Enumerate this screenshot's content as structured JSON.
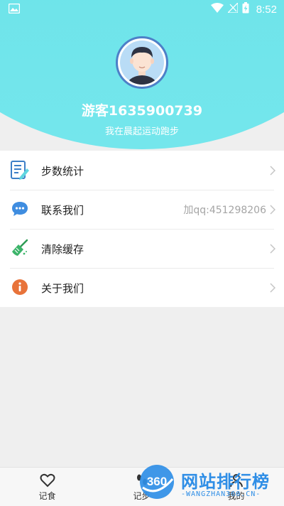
{
  "status_bar": {
    "time": "8:52"
  },
  "profile": {
    "username": "游客1635900739",
    "motto": "我在晨起运动跑步"
  },
  "menu": [
    {
      "label": "步数统计",
      "value": "",
      "icon": "document-edit-icon"
    },
    {
      "label": "联系我们",
      "value": "加qq:451298206",
      "icon": "chat-bubble-icon"
    },
    {
      "label": "清除缓存",
      "value": "",
      "icon": "broom-icon"
    },
    {
      "label": "关于我们",
      "value": "",
      "icon": "info-icon"
    }
  ],
  "tabs": [
    {
      "label": "记食",
      "icon": "heart-icon"
    },
    {
      "label": "记步",
      "icon": "footsteps-icon"
    },
    {
      "label": "我的",
      "icon": "person-icon"
    }
  ],
  "watermark": {
    "logo_text": "360",
    "title": "网站排行榜",
    "subtitle": "-WANGZHAN360.CN-"
  },
  "colors": {
    "header_gradient_top": "#8ff0f2",
    "header_gradient_bottom": "#6ee4ea",
    "watermark_blue": "#2f8ee6"
  }
}
